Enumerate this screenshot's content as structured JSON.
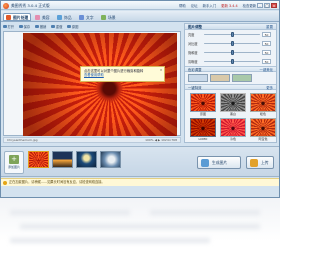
{
  "window": {
    "title": "美图秀秀 3.0.4 正式版",
    "top_links": [
      "帮助",
      "论坛",
      "新手入门",
      "更新 3.4.4",
      "检查更新"
    ],
    "buttons": [
      "-",
      "□",
      "×"
    ]
  },
  "tabs": [
    {
      "label": "图片处理",
      "icon_color": "#e25a2a",
      "active": true
    },
    {
      "label": "美容",
      "icon_color": "#e48db0",
      "active": false
    },
    {
      "label": "饰品",
      "icon_color": "#5aa0d8",
      "active": false
    },
    {
      "label": "文字",
      "icon_color": "#6a8fd6",
      "active": false
    },
    {
      "label": "场景",
      "icon_color": "#7fb25a",
      "active": false
    }
  ],
  "toolbar": {
    "items": [
      "打开",
      "保存",
      "撤销",
      "重做",
      "原图"
    ]
  },
  "canvas": {
    "popup": {
      "text": "点击这里可以对整个图片进行裁剪和旋转",
      "link": "查看使用帮助",
      "close": "×"
    },
    "status_left": "Chrysanthemum.jpg",
    "status_right": "100%   ◀ ▶   1024×768"
  },
  "right_panel": {
    "header": "图片调整",
    "header_action": "重置",
    "sliders": [
      {
        "label": "亮度",
        "value": 50
      },
      {
        "label": "对比度",
        "value": 50
      },
      {
        "label": "饱和度",
        "value": 50
      },
      {
        "label": "清晰度",
        "value": 50
      }
    ],
    "color_section": "色彩调整",
    "color_action": "一键美化",
    "swatches": [
      "#c9d9e9",
      "#d9c9a9",
      "#a9c9a9"
    ],
    "effects_section": "一键特效",
    "effects_action": "更多",
    "effects": [
      {
        "name": "原图",
        "variant": ""
      },
      {
        "name": "黑白",
        "variant": "bw"
      },
      {
        "name": "暖色",
        "variant": "warm"
      },
      {
        "name": "LOMO",
        "variant": "dark"
      },
      {
        "name": "冷色",
        "variant": "cool"
      },
      {
        "name": "阿宝色",
        "variant": "warm"
      }
    ]
  },
  "strip": {
    "add_label": "添加图片",
    "primary_button": "生成图片",
    "secondary_button": "上传"
  },
  "tip": "正在加载图片，请稍候……如果长时间没有反应，请检查网络连接。"
}
